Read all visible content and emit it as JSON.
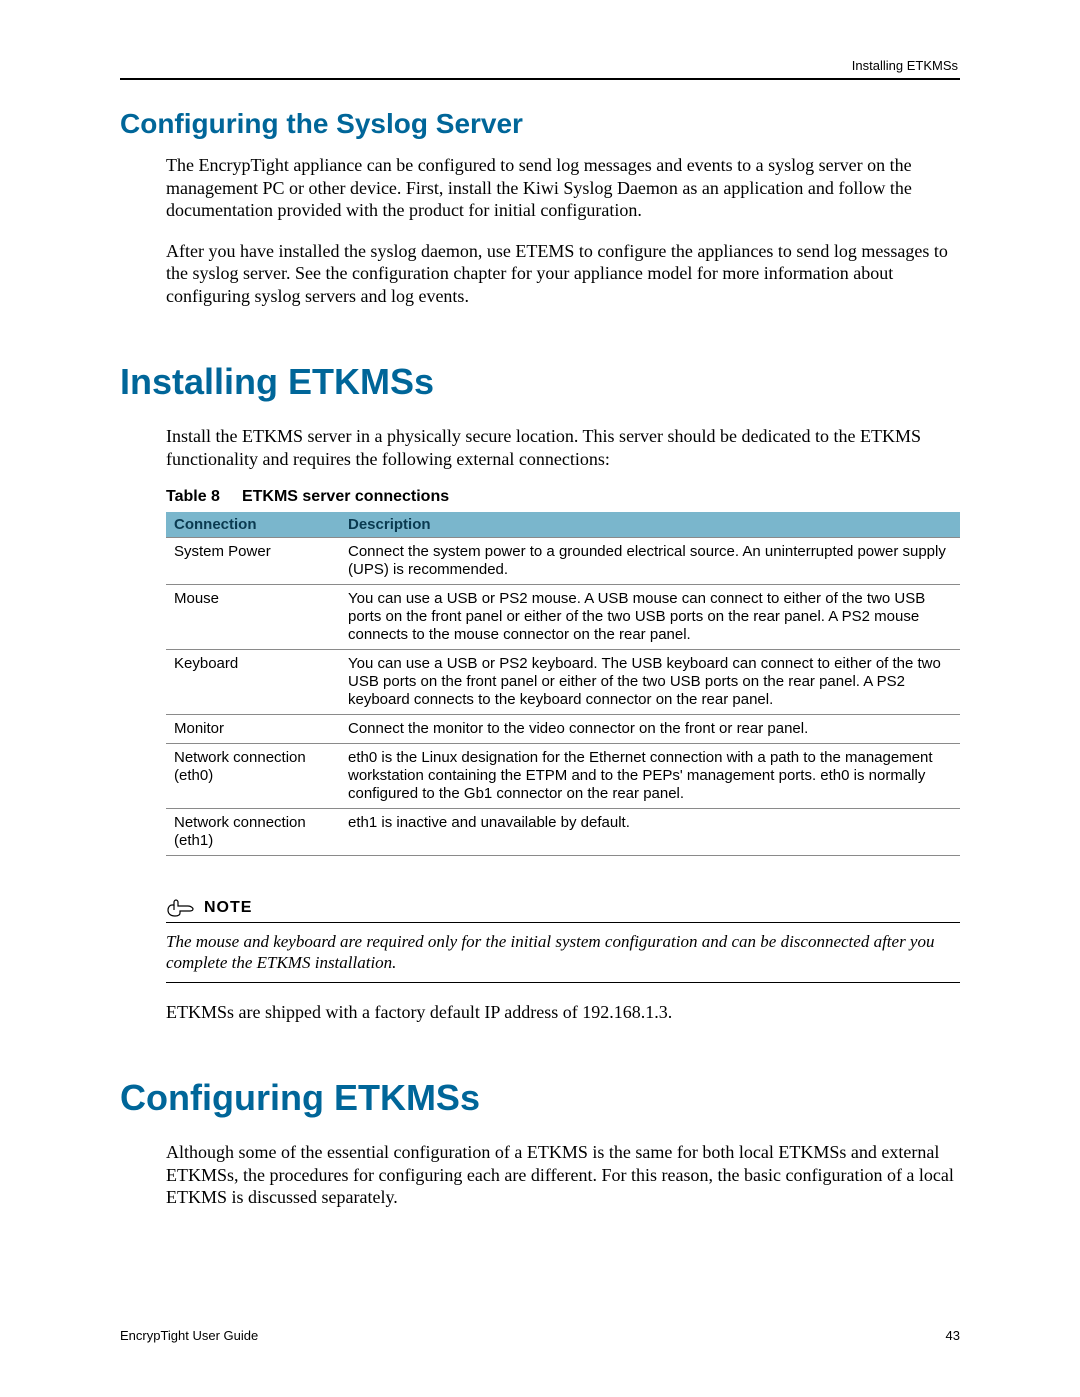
{
  "header": {
    "running_header": "Installing ETKMSs"
  },
  "section1": {
    "title": "Configuring the Syslog Server",
    "para1": "The EncrypTight appliance can be configured to send log messages and events to a syslog server on the management PC or other device. First, install the Kiwi Syslog Daemon as an application and follow the documentation provided with the product for initial configuration.",
    "para2": "After you have installed the syslog daemon, use ETEMS to configure the appliances to send log messages to the syslog server. See the configuration chapter for your appliance model for more information about configuring syslog servers and log events."
  },
  "section2": {
    "title": "Installing ETKMSs",
    "intro": "Install the ETKMS server in a physically secure location. This server should be dedicated to the ETKMS functionality and requires the following external connections:",
    "table_caption_prefix": "Table 8",
    "table_caption_title": "ETKMS server connections",
    "table": {
      "headers": [
        "Connection",
        "Description"
      ],
      "rows": [
        {
          "conn": "System Power",
          "desc": "Connect the system power to a grounded electrical source. An uninterrupted power supply (UPS) is recommended."
        },
        {
          "conn": "Mouse",
          "desc": "You can use a USB or PS2 mouse. A USB mouse can connect to either of the two USB ports on the front panel or either of the two USB ports on the rear panel. A PS2 mouse connects to the mouse connector on the rear panel."
        },
        {
          "conn": "Keyboard",
          "desc": "You can use a USB or PS2 keyboard. The USB keyboard can connect to either of the two USB ports on the front panel or either of the two USB ports on the rear panel. A PS2 keyboard connects to the keyboard connector on the rear panel."
        },
        {
          "conn": "Monitor",
          "desc": "Connect the monitor to the video connector on the front or rear panel."
        },
        {
          "conn": "Network connection (eth0)",
          "desc": "eth0 is the Linux designation for the Ethernet connection with a path to the management workstation containing the ETPM and to the PEPs' management ports. eth0 is normally configured to the Gb1 connector on the rear panel."
        },
        {
          "conn": "Network connection (eth1)",
          "desc": "eth1 is inactive and unavailable by default."
        }
      ]
    },
    "note_label": "NOTE",
    "note_body": "The mouse and keyboard are required only for the initial system configuration and can be disconnected after you complete the ETKMS installation.",
    "after_note": "ETKMSs are shipped with a factory default IP address of 192.168.1.3."
  },
  "section3": {
    "title": "Configuring ETKMSs",
    "para1": "Although some of the essential configuration of a ETKMS is the same for both local ETKMSs and external ETKMSs, the procedures for configuring each are different. For this reason, the basic configuration of a local ETKMS is discussed separately."
  },
  "footer": {
    "left": "EncrypTight User Guide",
    "right": "43"
  }
}
